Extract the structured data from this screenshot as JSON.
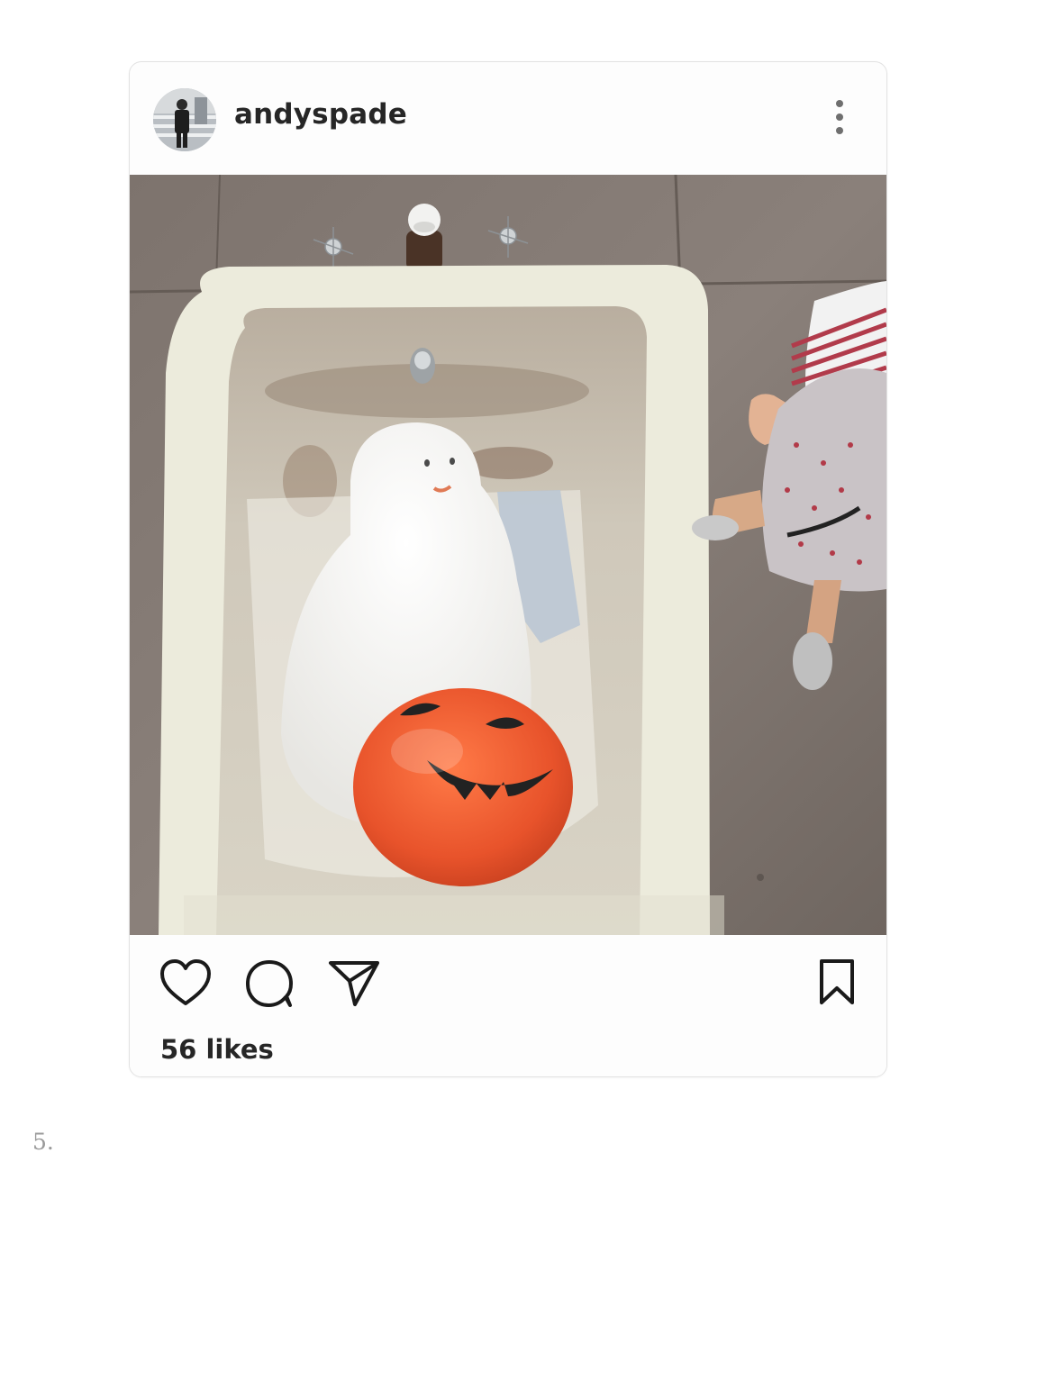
{
  "post": {
    "username": "andyspade",
    "avatar_icon": "user-avatar-photo",
    "menu_icon": "more-vertical-icon",
    "photo_subject": "ghost-and-pumpkin-in-bathtub-photo",
    "actions": {
      "like_icon": "heart-icon",
      "comment_icon": "comment-bubble-icon",
      "share_icon": "paper-plane-icon",
      "save_icon": "bookmark-icon"
    },
    "likes": "56 likes"
  },
  "page": {
    "item_number": "5."
  },
  "colors": {
    "text": "#262626",
    "card_border": "#e2e2e2",
    "pumpkin": "#e8532b",
    "tub": "#ecebdc"
  }
}
